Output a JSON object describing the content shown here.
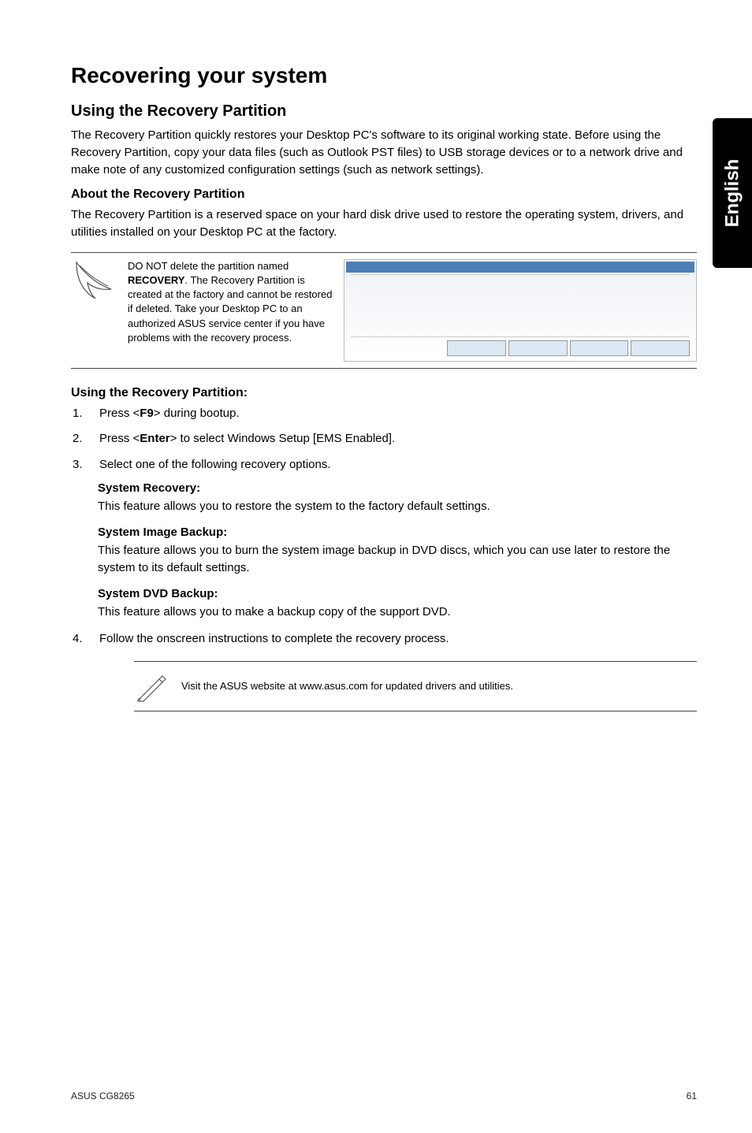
{
  "side_tab": "English",
  "title": "Recovering your system",
  "section1": {
    "heading": "Using the Recovery Partition",
    "paragraph": "The Recovery Partition quickly restores your Desktop PC's software to its original working state. Before using the Recovery Partition, copy your data files (such as Outlook PST files) to USB storage devices or to a network drive and make note of any customized configuration settings (such as network settings)."
  },
  "section2": {
    "heading": "About the Recovery Partition",
    "paragraph": "The Recovery Partition is a reserved space on your hard disk drive used to restore the operating system, drivers, and utilities installed on your Desktop PC at the factory."
  },
  "callout": {
    "prefix": "DO NOT delete the partition named ",
    "bold": "RECOVERY",
    "suffix": ". The Recovery Partition is created at the factory and cannot be restored if deleted. Take your Desktop PC to an authorized ASUS service center if you have problems with the recovery process."
  },
  "usage": {
    "heading": "Using the Recovery Partition:",
    "steps": [
      {
        "num": "1.",
        "pre": "Press <",
        "bold": "F9",
        "post": "> during bootup."
      },
      {
        "num": "2.",
        "pre": "Press <",
        "bold": "Enter",
        "post": "> to select Windows Setup [EMS Enabled]."
      },
      {
        "num": "3.",
        "pre": "",
        "bold": "",
        "post": "Select one of the following recovery options."
      }
    ],
    "options": [
      {
        "title": "System Recovery:",
        "desc": "This feature allows you to restore the system to the factory default settings."
      },
      {
        "title": "System Image Backup:",
        "desc": "This feature allows you to burn the system image backup in DVD discs, which you can use later to restore the system to its default settings."
      },
      {
        "title": "System DVD Backup:",
        "desc": "This feature allows you to make a backup copy of the support DVD."
      }
    ],
    "step4": {
      "num": "4.",
      "text": "Follow the onscreen instructions to complete the recovery process."
    }
  },
  "note": "Visit the ASUS website at www.asus.com for updated drivers and utilities.",
  "footer": {
    "left": "ASUS CG8265",
    "right": "61"
  }
}
